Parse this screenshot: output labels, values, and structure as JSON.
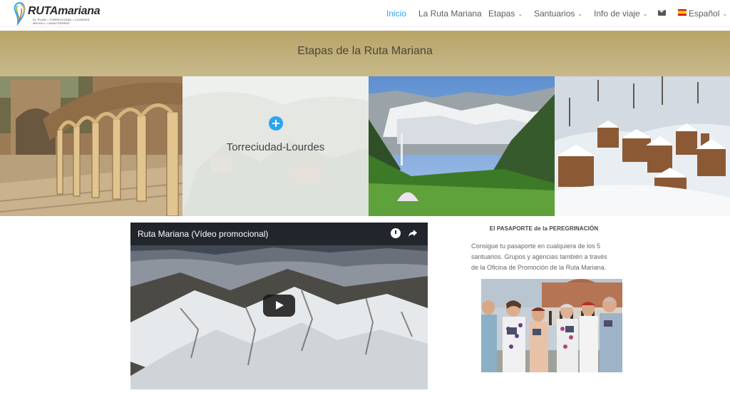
{
  "logo": {
    "main_bold": "RUTA",
    "main_rest": "mariana",
    "line1": "EL PILAR • TORRECIUDAD • LOURDES",
    "line2": "MEIXELL • MONTSERRAT"
  },
  "nav": {
    "items": [
      {
        "label": "Inicio",
        "active": true
      },
      {
        "label": "La Ruta Mariana"
      },
      {
        "label": "Etapas",
        "dropdown": true
      },
      {
        "label": "Santuarios",
        "dropdown": true
      },
      {
        "label": "Info de viaje",
        "dropdown": true
      }
    ],
    "mail_icon": "envelope-icon",
    "language": "Español",
    "flag": "spain-flag-icon",
    "accent_color": "#2ea3f2"
  },
  "banner": {
    "title": "Etapas de la Ruta Mariana",
    "color": "#bfae77"
  },
  "slider": {
    "tiles": [
      {
        "image": "cloister-arches-photo"
      },
      {
        "image": "faded-village-photo",
        "caption": "Torreciudad-Lourdes",
        "icon": "plus-icon"
      },
      {
        "image": "pyrenees-valley-photo"
      },
      {
        "image": "snowy-village-photo"
      }
    ],
    "next_arrow": "›"
  },
  "video": {
    "title": "Ruta Mariana (Vídeo promocional)",
    "icons": [
      "clock-icon",
      "share-icon",
      "play-icon"
    ]
  },
  "passport": {
    "title": "El PASAPORTE de la PEREGRINACIÓN",
    "lines": [
      "Consigue tu pasaporte en cualquiera de los 5",
      "santuarios. Grupos y agencias también a través",
      "de la Oficina de Promoción de la Ruta Mariana."
    ],
    "photo": "pilgrims-with-passports-photo"
  }
}
